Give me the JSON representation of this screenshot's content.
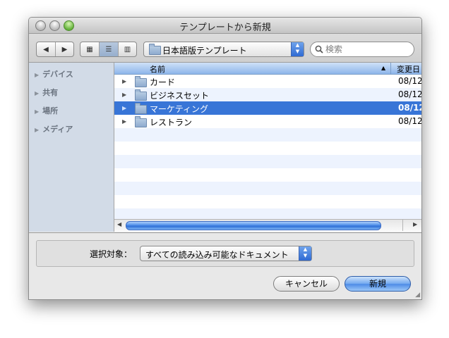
{
  "window": {
    "title": "テンプレートから新規"
  },
  "toolbar": {
    "back_glyph": "◀",
    "forward_glyph": "▶",
    "view_icons_glyph": "▦",
    "view_list_glyph": "☰",
    "view_columns_glyph": "▥",
    "location": "日本語版テンプレート",
    "search_placeholder": "検索"
  },
  "sidebar": {
    "items": [
      {
        "label": "デバイス"
      },
      {
        "label": "共有"
      },
      {
        "label": "場所"
      },
      {
        "label": "メディア"
      }
    ]
  },
  "list": {
    "columns": {
      "name": "名前",
      "date": "変更日"
    },
    "sort_glyph": "▲",
    "rows": [
      {
        "name": "カード",
        "date": "08/12"
      },
      {
        "name": "ビジネスセット",
        "date": "08/12"
      },
      {
        "name": "マーケティング",
        "date": "08/12"
      },
      {
        "name": "レストラン",
        "date": "08/12"
      }
    ]
  },
  "footer": {
    "filter_label": "選択対象：",
    "filter_value": "すべての読み込み可能なドキュメント",
    "cancel_label": "キャンセル",
    "ok_label": "新規"
  },
  "colors": {
    "selection": "#3875d7",
    "sidebar_bg": "#d2dbe7",
    "accent_blue": "#4d8be6"
  },
  "icons": [
    "back-arrow-icon",
    "forward-arrow-icon",
    "icon-view-icon",
    "list-view-icon",
    "column-view-icon",
    "folder-icon",
    "magnifier-icon",
    "disclosure-triangle-icon",
    "resize-grip-icon"
  ]
}
